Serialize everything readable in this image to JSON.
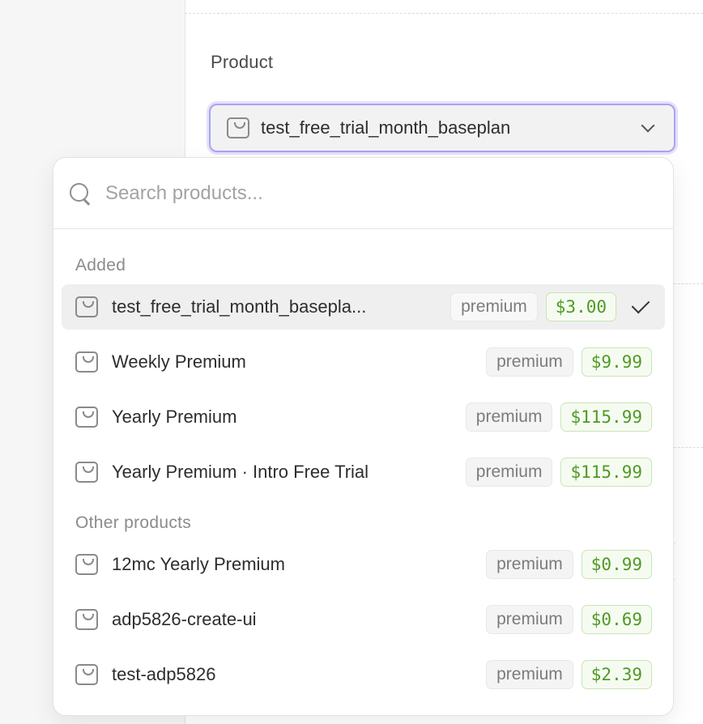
{
  "field": {
    "label": "Product",
    "selected_value": "test_free_trial_month_baseplan",
    "icon": "shopping-bag-icon"
  },
  "search": {
    "placeholder": "Search products...",
    "value": "",
    "icon": "search-icon"
  },
  "groups": [
    {
      "label": "Added",
      "items": [
        {
          "name": "test_free_trial_month_basepla...",
          "tag": "premium",
          "price": "$3.00",
          "selected": true
        },
        {
          "name": "Weekly Premium",
          "tag": "premium",
          "price": "$9.99",
          "selected": false
        },
        {
          "name": "Yearly Premium",
          "tag": "premium",
          "price": "$115.99",
          "selected": false
        },
        {
          "name": "Yearly Premium · Intro Free Trial",
          "tag": "premium",
          "price": "$115.99",
          "selected": false
        }
      ]
    },
    {
      "label": "Other products",
      "items": [
        {
          "name": "12mc Yearly Premium",
          "tag": "premium",
          "price": "$0.99",
          "selected": false
        },
        {
          "name": "adp5826-create-ui",
          "tag": "premium",
          "price": "$0.69",
          "selected": false
        },
        {
          "name": "test-adp5826",
          "tag": "premium",
          "price": "$2.39",
          "selected": false
        }
      ]
    }
  ],
  "colors": {
    "focus_ring": "#a9a3f3",
    "price_text": "#4f9a24",
    "price_border": "#c9e4b6",
    "selected_row": "#efefef"
  }
}
